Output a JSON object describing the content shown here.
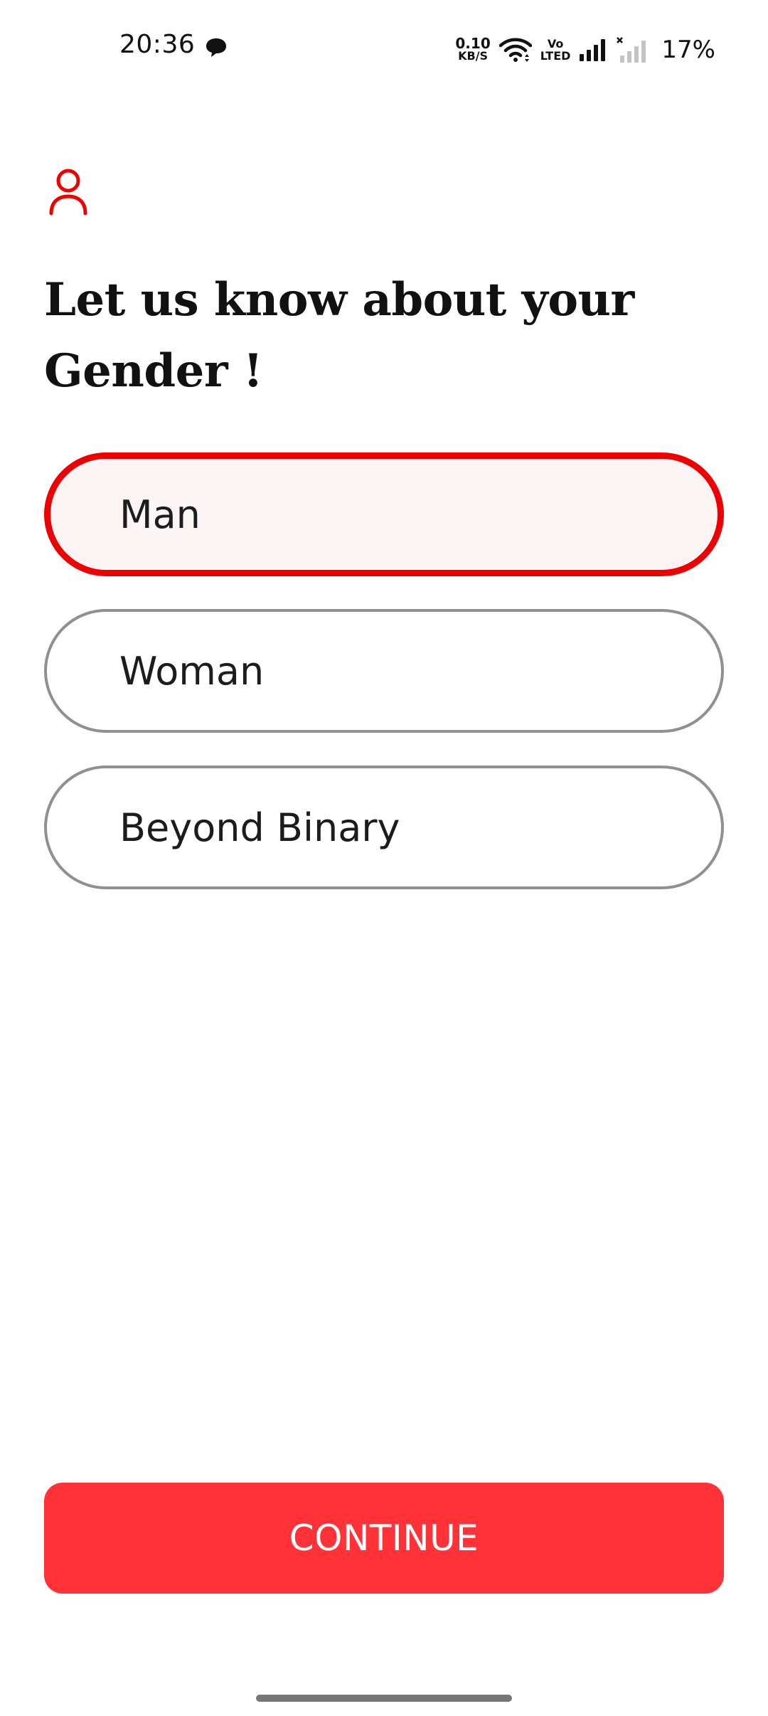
{
  "status_bar": {
    "time": "20:36",
    "net_speed_value": "0.10",
    "net_speed_unit": "KB/S",
    "volte_top": "Vo",
    "volte_bottom": "LTED",
    "battery": "17%",
    "icons": [
      "chat-bubble-icon",
      "wifi-icon",
      "signal-icon",
      "signal-x-icon"
    ]
  },
  "header": {
    "icon": "user-icon",
    "title": "Let us know about your Gender !"
  },
  "options": [
    {
      "label": "Man",
      "selected": true
    },
    {
      "label": "Woman",
      "selected": false
    },
    {
      "label": "Beyond Binary",
      "selected": false
    }
  ],
  "continue_label": "CONTINUE",
  "colors": {
    "accent": "#ee0000",
    "button": "#ff3337",
    "selected_bg": "#faf4f4",
    "border": "#909090"
  }
}
